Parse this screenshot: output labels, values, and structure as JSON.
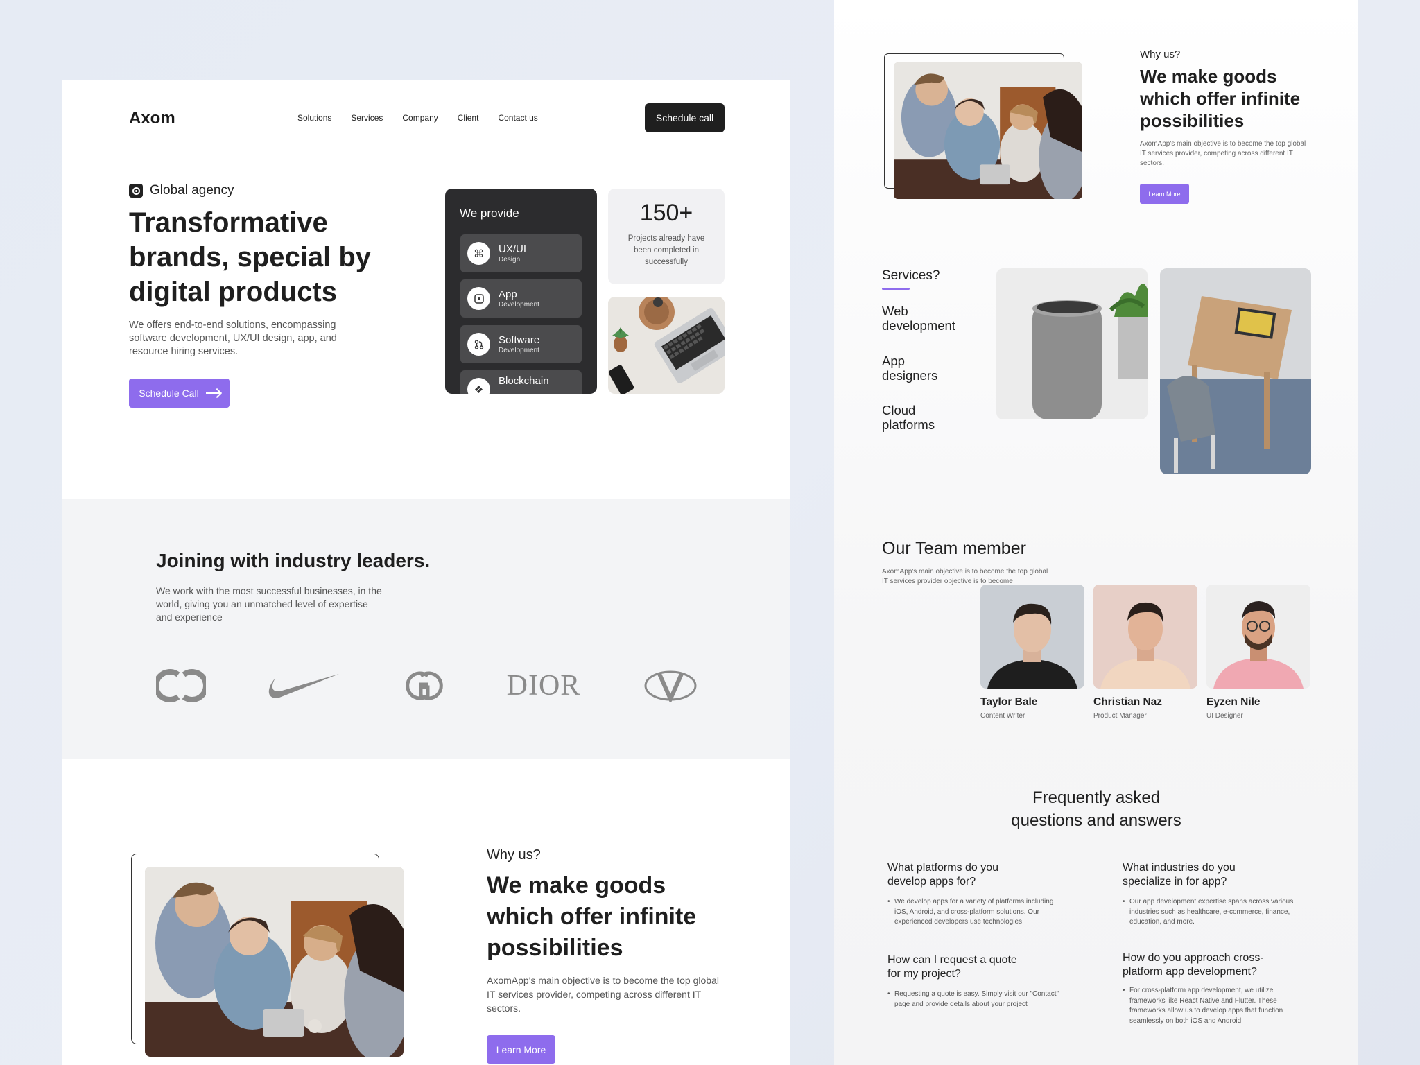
{
  "colors": {
    "accent": "#8e6ced",
    "dark": "#1f1f1f",
    "card_dark": "#2c2c2e",
    "band": "#f3f4f6"
  },
  "left": {
    "logo": "Axom",
    "nav": [
      "Solutions",
      "Services",
      "Company",
      "Client",
      "Contact us"
    ],
    "cta": "Schedule call",
    "hero": {
      "tag": "Global agency",
      "title": "Transformative brands, special by digital products",
      "description": "We offers end-to-end solutions, encompassing software development, UX/UI design, app, and resource hiring services.",
      "button": "Schedule Call"
    },
    "provide": {
      "title": "We provide",
      "items": [
        {
          "title": "UX/UI",
          "sub": "Design",
          "icon": "command-icon"
        },
        {
          "title": "App",
          "sub": "Development",
          "icon": "app-icon"
        },
        {
          "title": "Software",
          "sub": "Development",
          "icon": "git-icon"
        },
        {
          "title": "Blockchain",
          "sub": "",
          "icon": "blockchain-icon"
        }
      ]
    },
    "stat": {
      "value": "150+",
      "label": "Projects already have been completed in successfully"
    },
    "leaders": {
      "title": "Joining  with industry leaders.",
      "description": "We work with the most successful businesses, in the world, giving you an unmatched level of expertise and experience",
      "brands": [
        "chanel-logo",
        "nike-logo",
        "gucci-logo",
        "DIOR",
        "valentino-logo"
      ]
    },
    "why": {
      "label": "Why us?",
      "title": "We make goods which offer infinite possibilities",
      "description": "AxomApp's main objective is to become the top global IT services provider, competing across different IT sectors.",
      "button": "Learn More"
    }
  },
  "right": {
    "why": {
      "label": "Why us?",
      "title": "We make goods which offer infinite possibilities",
      "description": "AxomApp's main objective is to become the top global IT services provider, competing across different IT sectors.",
      "button": "Learn More"
    },
    "services": {
      "label": "Services?",
      "items": [
        "Web development",
        "App designers",
        "Cloud platforms"
      ]
    },
    "team": {
      "title": "Our Team member",
      "description": "AxomApp's main objective is to become the top global IT services provider objective is to become",
      "members": [
        {
          "name": "Taylor Bale",
          "role": "Content Writer"
        },
        {
          "name": "Christian Naz",
          "role": "Product Manager"
        },
        {
          "name": "Eyzen Nile",
          "role": "UI Designer"
        }
      ]
    },
    "faq": {
      "title": "Frequently asked questions and answers",
      "items": [
        {
          "q": "What platforms do you develop apps for?",
          "a": "We develop apps for a variety of platforms including iOS, Android, and cross-platform solutions. Our experienced developers use technologies"
        },
        {
          "q": "What industries do you specialize in for app?",
          "a": "Our app development expertise spans across various industries such as healthcare, e-commerce, finance, education, and more."
        },
        {
          "q": "How can I request a quote for my project?",
          "a": "Requesting a quote is easy. Simply visit our \"Contact\" page and provide details about your project"
        },
        {
          "q": "How do you approach cross-platform app development?",
          "a": "For cross-platform app development, we utilize frameworks like React Native and Flutter. These frameworks allow us to develop apps that function seamlessly on both iOS and Android"
        }
      ]
    }
  }
}
